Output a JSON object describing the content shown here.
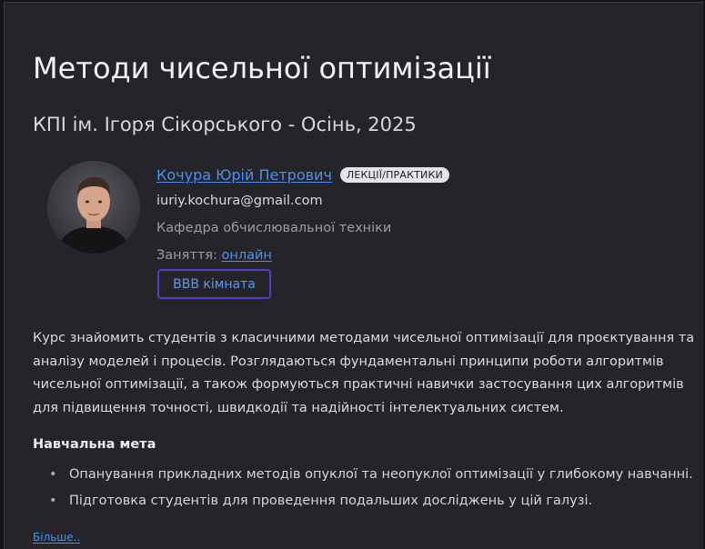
{
  "course": {
    "title": "Методи чисельної оптимізації",
    "subtitle": "КПІ ім. Ігоря Сікорського - Осінь, 2025"
  },
  "instructor": {
    "name": "Кочура Юрій Петрович",
    "role": "ЛЕКЦІЇ/ПРАКТИКИ",
    "email": "iuriy.kochura@gmail.com",
    "department": "Кафедра обчислювальної техніки",
    "classes_label": "Заняття:",
    "classes_mode": "онлайн",
    "room_button": "BBB кімната"
  },
  "description": "Курс знайомить студентів з класичними методами чисельної оптимізації для проєктування та аналізу моделей і процесів. Розглядаються фундаментальні принципи роботи алгоритмів чисельної оптимізації, а також формуються практичні навички застосування цих алгоритмів для підвищення точності, швидкодії та надійності інтелектуальних систем.",
  "goal": {
    "heading": "Навчальна мета",
    "items": [
      "Опанування прикладних методів опуклої та неопуклої оптимізації у глибокому навчанні.",
      "Підготовка студентів для проведення подальших досліджень у цій галузі."
    ]
  },
  "more_link": "Більше..",
  "colors": {
    "background": "#252529",
    "link": "#4b90f0",
    "button_border": "#4b43c4"
  }
}
